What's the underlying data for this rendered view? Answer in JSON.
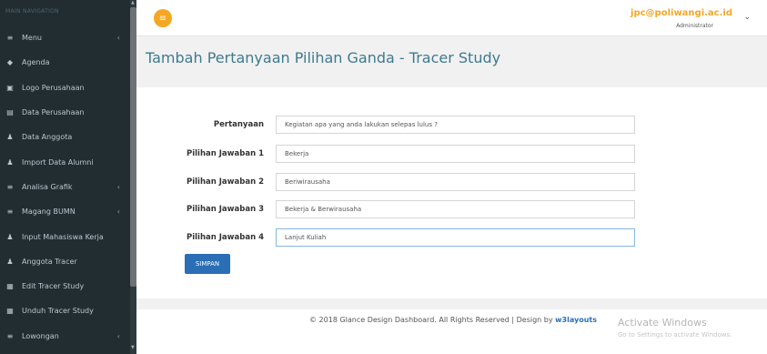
{
  "sidebar": {
    "header": "MAIN NAVIGATION",
    "items": [
      {
        "label": "Menu",
        "icon": "≡",
        "has_caret": true
      },
      {
        "label": "Agenda",
        "icon": "◆",
        "has_caret": false
      },
      {
        "label": "Logo Perusahaan",
        "icon": "▣",
        "has_caret": false
      },
      {
        "label": "Data Perusahaan",
        "icon": "▤",
        "has_caret": false
      },
      {
        "label": "Data Anggota",
        "icon": "♟",
        "has_caret": false
      },
      {
        "label": "Import Data Alumni",
        "icon": "♟",
        "has_caret": false
      },
      {
        "label": "Analisa Grafik",
        "icon": "≡",
        "has_caret": true
      },
      {
        "label": "Magang BUMN",
        "icon": "≡",
        "has_caret": true
      },
      {
        "label": "Input Mahasiswa Kerja",
        "icon": "♟",
        "has_caret": false
      },
      {
        "label": "Anggota Tracer",
        "icon": "♟",
        "has_caret": false
      },
      {
        "label": "Edit Tracer Study",
        "icon": "▦",
        "has_caret": false
      },
      {
        "label": "Unduh Tracer Study",
        "icon": "▦",
        "has_caret": false
      },
      {
        "label": "Lowongan",
        "icon": "≡",
        "has_caret": true
      }
    ],
    "caret": "‹"
  },
  "topbar": {
    "menu_icon": "≡",
    "user_email": "jpc@poliwangi.ac.id",
    "user_role": "Administrator",
    "chevron": "⌄"
  },
  "page": {
    "title": "Tambah Pertanyaan Pilihan Ganda - Tracer Study"
  },
  "form": {
    "question_label": "Pertanyaan",
    "question_value": "Kegiatan apa yang anda lakukan selepas lulus ?",
    "answer1_label": "Pilihan Jawaban 1",
    "answer1_value": "Bekerja",
    "answer2_label": "Pilihan Jawaban 2",
    "answer2_value": "Beriwirausaha",
    "answer3_label": "Pilihan Jawaban 3",
    "answer3_value": "Bekerja & Berwirausaha",
    "answer4_label": "Pilihan Jawaban 4",
    "answer4_value": "Lanjut Kuliah",
    "save_label": "SIMPAN"
  },
  "footer": {
    "text": "© 2018 Glance Design Dashboard. All Rights Reserved | Design by ",
    "link": "w3layouts"
  },
  "watermark": {
    "title": "Activate Windows",
    "subtitle": "Go to Settings to activate Windows."
  },
  "colors": {
    "sidebar_bg": "#222d32",
    "accent": "#f5a623",
    "title": "#3e7a8f",
    "button": "#2a6fb5"
  }
}
